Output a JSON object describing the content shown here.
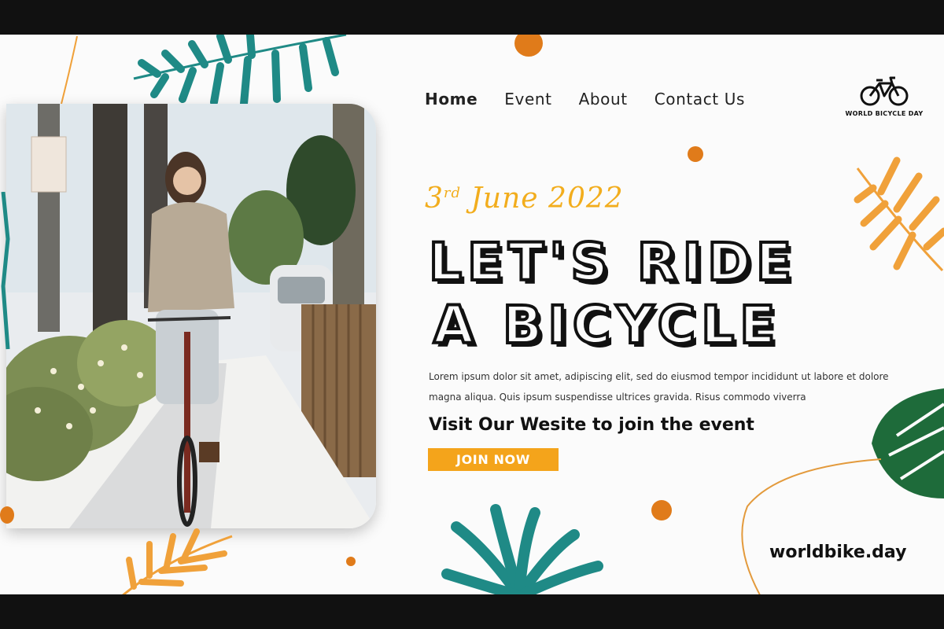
{
  "nav": {
    "items": [
      {
        "label": "Home",
        "active": true
      },
      {
        "label": "Event",
        "active": false
      },
      {
        "label": "About",
        "active": false
      },
      {
        "label": "Contact Us",
        "active": false
      }
    ]
  },
  "logo": {
    "text": "WORLD BICYCLE DAY",
    "icon": "bicycle-icon"
  },
  "hero": {
    "date_day": "3",
    "date_suffix": "rd",
    "date_rest": "June 2022",
    "headline_line1": "LET'S RIDE",
    "headline_line2": "A BICYCLE",
    "body": "Lorem ipsum dolor sit amet, adipiscing elit, sed do eiusmod tempor incididunt ut labore et dolore magna aliqua. Quis ipsum suspendisse ultrices gravida. Risus commodo viverra",
    "visit_text": "Visit Our Wesite to join the event",
    "join_label": "JOIN NOW",
    "website": "worldbike.day"
  },
  "colors": {
    "accent_orange": "#f4a41b",
    "dot_orange": "#e07b1a",
    "teal_leaf": "#1f8a86",
    "dark_green_leaf": "#1e6b3a",
    "gold_leaf": "#f0a13a"
  }
}
